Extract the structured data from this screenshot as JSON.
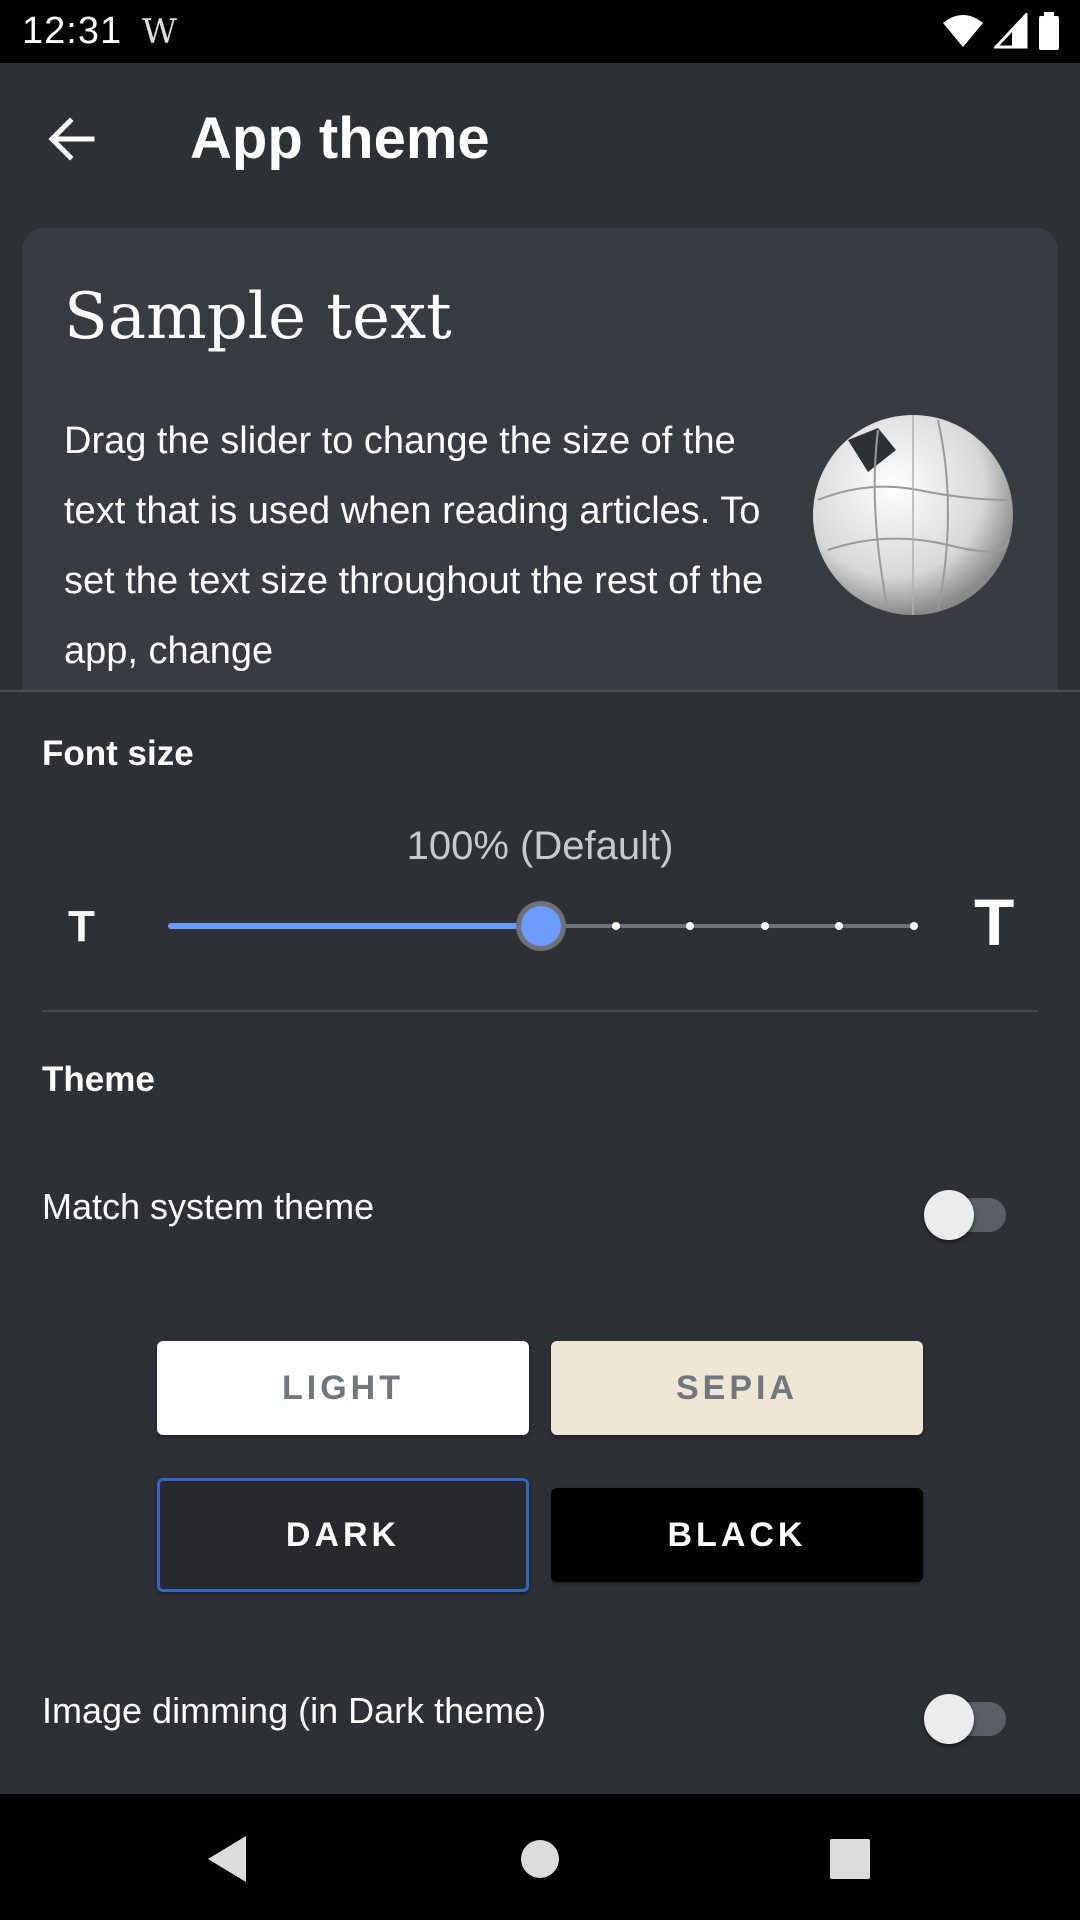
{
  "status_bar": {
    "time": "12:31",
    "app_icon": "W",
    "icons": [
      "wifi-icon",
      "signal-icon",
      "battery-icon"
    ]
  },
  "header": {
    "back_icon": "arrow-left-icon",
    "title": "App theme"
  },
  "sample": {
    "title": "Sample text",
    "body": "Drag the slider to change the size of the text that is used when reading articles. To set the text size throughout the rest of the app, change",
    "image": "wikipedia-globe-icon"
  },
  "font_size": {
    "label": "Font size",
    "value_text": "100% (Default)",
    "small_icon_text": "T",
    "large_icon_text": "T",
    "slider": {
      "steps": 10,
      "selected_index": 5
    }
  },
  "theme": {
    "label": "Theme",
    "match_system": {
      "label": "Match system theme",
      "enabled": false
    },
    "options": [
      {
        "label": "LIGHT",
        "selected": false
      },
      {
        "label": "SEPIA",
        "selected": false
      },
      {
        "label": "DARK",
        "selected": true
      },
      {
        "label": "BLACK",
        "selected": false
      }
    ],
    "image_dimming": {
      "label": "Image dimming (in Dark theme)",
      "enabled": false
    }
  },
  "colors": {
    "accent": "#6c9cff",
    "selected_border": "#3366cc",
    "background": "#2d3035",
    "card": "#383b41"
  },
  "nav_bar": {
    "icons": [
      "back-triangle-icon",
      "home-circle-icon",
      "recents-square-icon"
    ]
  }
}
